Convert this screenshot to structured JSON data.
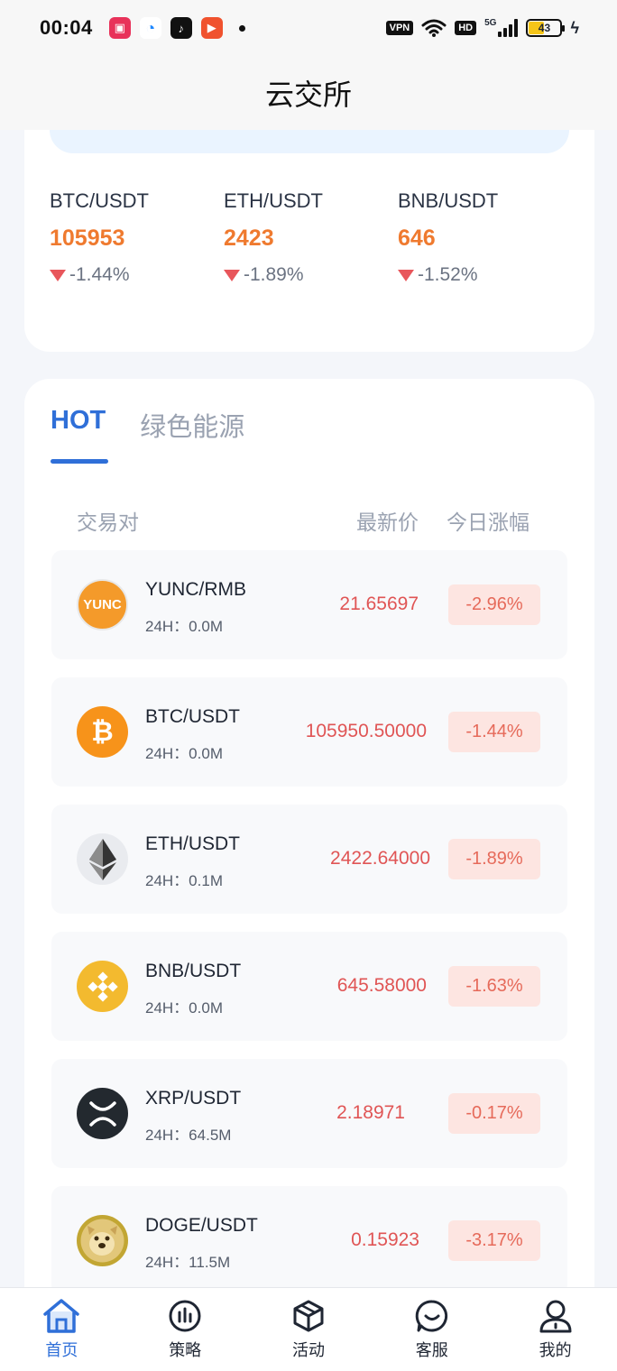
{
  "status_bar": {
    "time": "00:04",
    "vpn": "VPN",
    "hd": "HD",
    "network": "5G",
    "battery": "43"
  },
  "header": {
    "title": "云交所"
  },
  "tickers": [
    {
      "pair": "BTC/USDT",
      "price": "105953",
      "change": "-1.44%"
    },
    {
      "pair": "ETH/USDT",
      "price": "2423",
      "change": "-1.89%"
    },
    {
      "pair": "BNB/USDT",
      "price": "646",
      "change": "-1.52%"
    }
  ],
  "market": {
    "tabs": [
      {
        "label": "HOT",
        "active": true
      },
      {
        "label": "绿色能源",
        "active": false
      }
    ],
    "columns": {
      "pair": "交易对",
      "price": "最新价",
      "change": "今日涨幅"
    },
    "rows": [
      {
        "pair": "YUNC/RMB",
        "volume": "24H：0.0M",
        "price": "21.65697",
        "change": "-2.96%",
        "logo_text": "YUNC"
      },
      {
        "pair": "BTC/USDT",
        "volume": "24H：0.0M",
        "price": "105950.50000",
        "change": "-1.44%"
      },
      {
        "pair": "ETH/USDT",
        "volume": "24H：0.1M",
        "price": "2422.64000",
        "change": "-1.89%"
      },
      {
        "pair": "BNB/USDT",
        "volume": "24H：0.0M",
        "price": "645.58000",
        "change": "-1.63%"
      },
      {
        "pair": "XRP/USDT",
        "volume": "24H：64.5M",
        "price": "2.18971",
        "change": "-0.17%"
      },
      {
        "pair": "DOGE/USDT",
        "volume": "24H：11.5M",
        "price": "0.15923",
        "change": "-3.17%"
      }
    ]
  },
  "bottom_nav": [
    {
      "label": "首页",
      "icon": "home-icon",
      "active": true
    },
    {
      "label": "策略",
      "icon": "strategy-icon",
      "active": false
    },
    {
      "label": "活动",
      "icon": "activity-icon",
      "active": false
    },
    {
      "label": "客服",
      "icon": "support-icon",
      "active": false
    },
    {
      "label": "我的",
      "icon": "profile-icon",
      "active": false
    }
  ],
  "colors": {
    "accent": "#2f6fd8",
    "price_orange": "#ef7a2f",
    "down_red": "#e05555",
    "change_bg": "#fde5e1"
  }
}
